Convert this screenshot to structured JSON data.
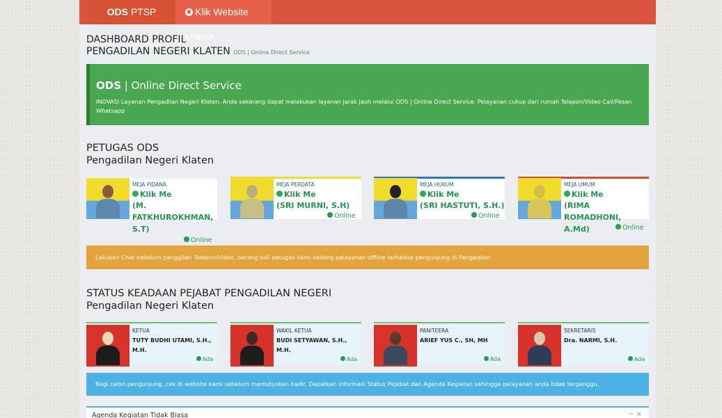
{
  "topbar": {
    "brand_bold": "ODS",
    "brand_rest": "PTSP",
    "website_label": "Klik Website Utama"
  },
  "header": {
    "line1": "DASHBOARD PROFIL",
    "line2": "PENGADILAN NEGERI KLATEN",
    "small": "ODS | Online Direct Service"
  },
  "intro": {
    "title_bold": "ODS",
    "title_rest": " | Online Direct Service",
    "text": "INOVASI Layanan Pengadilan Negeri Klaten. Anda sekarang dapat melakukan layanan jarak jauh melalui ODS | Online Direct Service. Pelayanan cukup dari rumah Telepon/Video Call/Pesan Whatsapp"
  },
  "petugas": {
    "title1": "PETUGAS ODS",
    "title2": "Pengadilan Negeri Klaten",
    "klik_label": "Klik Me",
    "status": "Online",
    "items": [
      {
        "role": "MEJA PIDANA",
        "name_lines": [
          "(M.",
          "FATKHUROKHMAN,",
          "S.T)"
        ],
        "line_color": "#e6f3fa"
      },
      {
        "role": "MEJA PERDATA",
        "name_lines": [
          "(SRI MURNI, S.H)"
        ],
        "line_color": "#f1dc2c"
      },
      {
        "role": "MEJA HUKUM",
        "name_lines": [
          "(SRI HASTUTI, S.H.)"
        ],
        "line_color": "#2f76c8"
      },
      {
        "role": "MEJA UMUM",
        "name_lines": [
          "(RIMA ROMADHONI,",
          "A.Md)"
        ],
        "line_color": "#e04a2f"
      }
    ],
    "notice": "Lakukan Chat sebelum panggilan Telepon/Video, barang kali petugas kami sedang pelayanan offline terhadap pengunjung di Pengadilan"
  },
  "pejabat": {
    "title1": "STATUS KEADAAN PEJABAT PENGADILAN NEGERI",
    "title2": "Pengadilan Negeri Klaten",
    "status": "Ada",
    "items": [
      {
        "role": "KETUA",
        "name_lines": [
          "TUTY BUDHI UTAMI, S.H.,",
          "M.H."
        ]
      },
      {
        "role": "WAKIL KETUA",
        "name_lines": [
          "BUDI SETYAWAN, S.H.,",
          "M.H."
        ]
      },
      {
        "role": "PANITEERA",
        "name_lines": [
          "ARIEF YUS C., SH, MH"
        ]
      },
      {
        "role": "SEKRETARIS",
        "name_lines": [
          "Dra. NARMI, S.H."
        ]
      }
    ],
    "notice": "Bagi calon pengunjung, cek di website kami sebelum memutuskan hadir. Dapatkan informasi Status Pejabat dan Agenda Kegiatan sehingga pelayanan anda tidak terganggu."
  },
  "agenda": {
    "title": "Agenda Kegiatan Tidak Biasa",
    "tools": "−  ×"
  }
}
